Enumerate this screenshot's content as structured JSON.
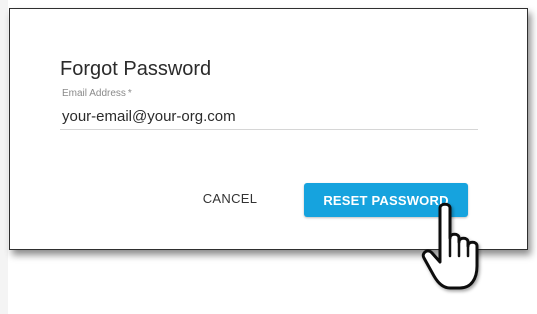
{
  "dialog": {
    "title": "Forgot Password",
    "email_label": "Email Address",
    "required_marker": "*",
    "email_value": "your-email@your-org.com"
  },
  "actions": {
    "cancel_label": "CANCEL",
    "reset_label": "RESET PASSWORD"
  },
  "cursor": {
    "icon": "hand-pointer-icon"
  },
  "colors": {
    "accent": "#16a3de",
    "text": "#2b2b2b",
    "label": "#8a8a8a"
  }
}
